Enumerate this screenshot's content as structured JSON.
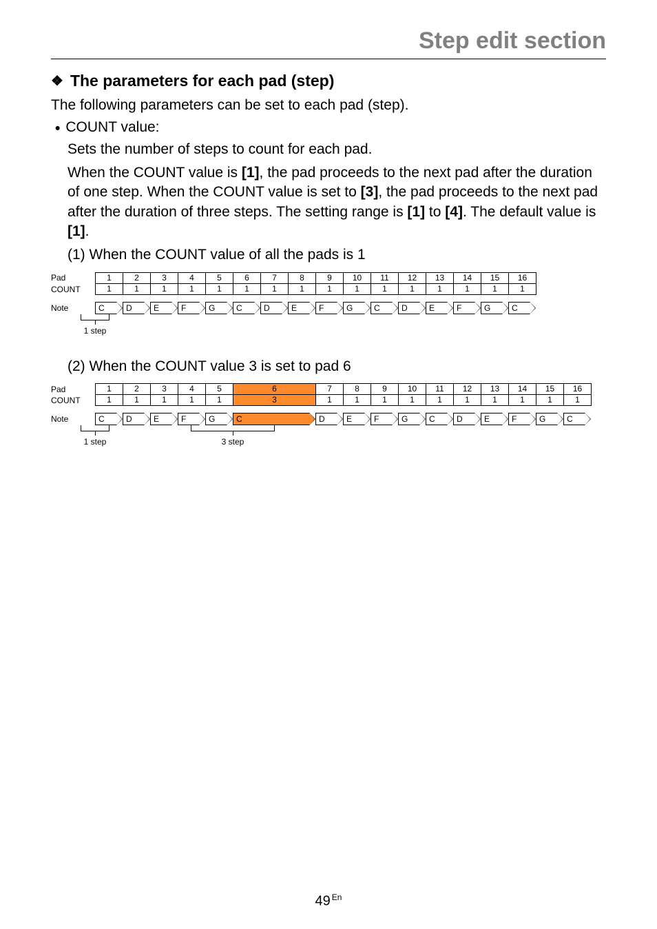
{
  "page_title": "Step edit section",
  "subhead": "The parameters for each pad (step)",
  "intro": "The following parameters can be set to each pad (step).",
  "count_label": "COUNT value:",
  "count_desc1": "Sets the number of steps to count for each pad.",
  "count_desc2a": "When the COUNT value is ",
  "count_desc2b": ", the pad proceeds to the next pad after the duration of one step. When the COUNT value is set to ",
  "count_desc2c": ", the pad proceeds to the next pad after the duration of three steps. The setting range is ",
  "count_desc2d": " to ",
  "count_desc2e": ". The default value is ",
  "count_desc2f": ".",
  "b1": "[1]",
  "b3": "[3]",
  "b4": "[4]",
  "b1b": "[1]",
  "case1_title": "(1) When the COUNT value of all the pads is 1",
  "case2_title": "(2) When the COUNT value 3 is set to pad 6",
  "labels": {
    "pad": "Pad",
    "count": "COUNT",
    "note": "Note"
  },
  "step1": "1 step",
  "step3": "3 step",
  "chart_data": [
    {
      "type": "table",
      "title": "COUNT value of all pads = 1",
      "pads": [
        "1",
        "2",
        "3",
        "4",
        "5",
        "6",
        "7",
        "8",
        "9",
        "10",
        "11",
        "12",
        "13",
        "14",
        "15",
        "16"
      ],
      "count": [
        "1",
        "1",
        "1",
        "1",
        "1",
        "1",
        "1",
        "1",
        "1",
        "1",
        "1",
        "1",
        "1",
        "1",
        "1",
        "1"
      ],
      "notes": [
        "C",
        "D",
        "E",
        "F",
        "G",
        "C",
        "D",
        "E",
        "F",
        "G",
        "C",
        "D",
        "E",
        "F",
        "G",
        "C"
      ],
      "widths": [
        1,
        1,
        1,
        1,
        1,
        1,
        1,
        1,
        1,
        1,
        1,
        1,
        1,
        1,
        1,
        1
      ],
      "highlight_index": null,
      "step_markers": [
        {
          "label": "1 step",
          "from": 0,
          "span": 1
        }
      ]
    },
    {
      "type": "table",
      "title": "COUNT value 3 set to pad 6",
      "pads": [
        "1",
        "2",
        "3",
        "4",
        "5",
        "6",
        "7",
        "8",
        "9",
        "10",
        "11",
        "12",
        "13",
        "14",
        "15",
        "16"
      ],
      "count": [
        "1",
        "1",
        "1",
        "1",
        "1",
        "3",
        "1",
        "1",
        "1",
        "1",
        "1",
        "1",
        "1",
        "1",
        "1",
        "1"
      ],
      "notes": [
        "C",
        "D",
        "E",
        "F",
        "G",
        "C",
        "D",
        "E",
        "F",
        "G",
        "C",
        "D",
        "E",
        "F",
        "G",
        "C"
      ],
      "widths": [
        1,
        1,
        1,
        1,
        1,
        3,
        1,
        1,
        1,
        1,
        1,
        1,
        1,
        1,
        1,
        1
      ],
      "highlight_index": 5,
      "step_markers": [
        {
          "label": "1 step",
          "from": 0,
          "span": 1
        },
        {
          "label": "3 step",
          "from": 5,
          "span": 3
        }
      ]
    }
  ],
  "page_number": "49",
  "page_lang": "En"
}
